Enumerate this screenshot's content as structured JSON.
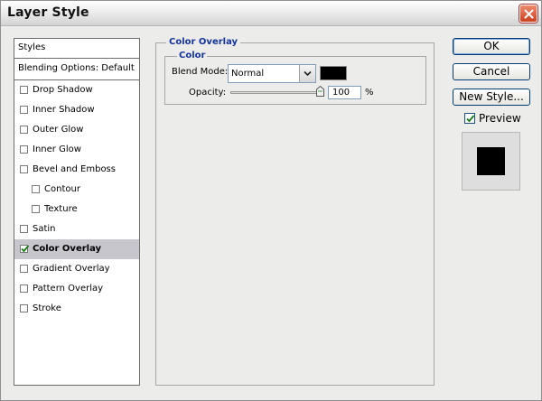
{
  "window": {
    "title": "Layer Style"
  },
  "styles": {
    "header": "Styles",
    "blending_options": "Blending Options: Default",
    "items": [
      {
        "label": "Drop Shadow",
        "checked": false
      },
      {
        "label": "Inner Shadow",
        "checked": false
      },
      {
        "label": "Outer Glow",
        "checked": false
      },
      {
        "label": "Inner Glow",
        "checked": false
      },
      {
        "label": "Bevel and Emboss",
        "checked": false
      },
      {
        "label": "Contour",
        "checked": false
      },
      {
        "label": "Texture",
        "checked": false
      },
      {
        "label": "Satin",
        "checked": false
      },
      {
        "label": "Color Overlay",
        "checked": true
      },
      {
        "label": "Gradient Overlay",
        "checked": false
      },
      {
        "label": "Pattern Overlay",
        "checked": false
      },
      {
        "label": "Stroke",
        "checked": false
      }
    ]
  },
  "overlay": {
    "group_title": "Color Overlay",
    "subgroup_title": "Color",
    "blend_mode_label": "Blend Mode:",
    "blend_mode_value": "Normal",
    "overlay_color": "#000000",
    "opacity_label": "Opacity:",
    "opacity_value": "100",
    "opacity_unit": "%",
    "opacity_fraction": 1.0
  },
  "buttons": {
    "ok": "OK",
    "cancel": "Cancel",
    "new_style": "New Style..."
  },
  "preview": {
    "label": "Preview",
    "checked": true
  },
  "icons": {
    "close": "close-icon",
    "check": "checkmark-icon",
    "dropdown": "chevron-down-icon",
    "slider": "slider-thumb-icon"
  },
  "colors": {
    "accent_heading": "#16349e",
    "selected_row": "#c6c6cc",
    "close_button": "#c8411f"
  }
}
